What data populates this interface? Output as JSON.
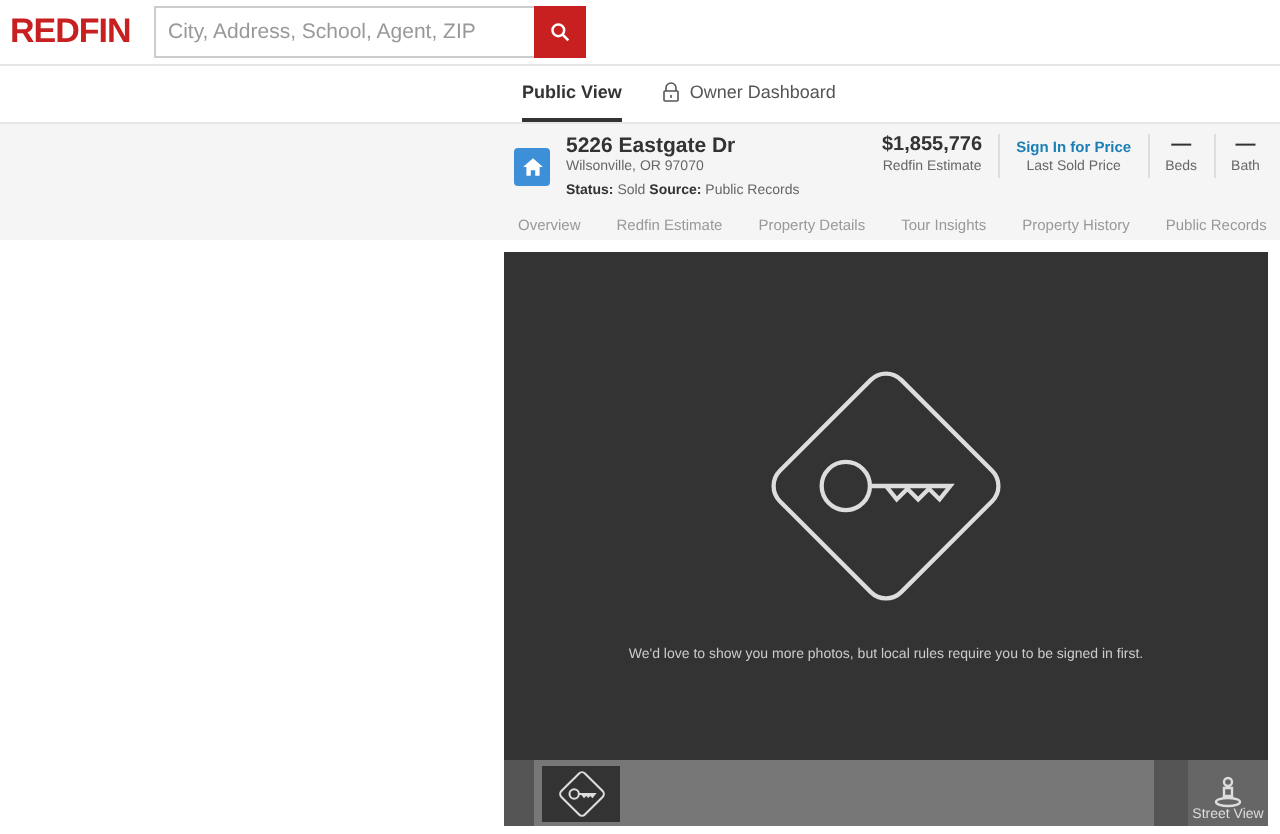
{
  "header": {
    "logo": "REDFIN",
    "search": {
      "placeholder": "City, Address, School, Agent, ZIP"
    }
  },
  "view_tabs": [
    {
      "label": "Public View",
      "selected": true,
      "kind": "plain"
    },
    {
      "label": "Owner Dashboard",
      "selected": false,
      "kind": "locked"
    }
  ],
  "property": {
    "address": "5226 Eastgate Dr",
    "city": "Wilsonville, OR 97070",
    "status_label": "Status:",
    "status": "Sold",
    "source_label": "Source:",
    "source": "Public Records"
  },
  "stats": [
    {
      "value": "$1,855,776",
      "label": "Redfin Estimate",
      "kind": "value"
    },
    {
      "value": "Sign In for Price",
      "label": "Last Sold Price",
      "kind": "link"
    },
    {
      "value": "—",
      "label": "Beds",
      "kind": "value"
    },
    {
      "value": "—",
      "label": "Bath",
      "kind": "value"
    }
  ],
  "section_nav": [
    "Overview",
    "Redfin Estimate",
    "Property Details",
    "Tour Insights",
    "Property History",
    "Public Records"
  ],
  "gallery": {
    "message": "We'd love to show you more photos, but local rules require you to be signed in first.",
    "street_view": "Street View"
  }
}
